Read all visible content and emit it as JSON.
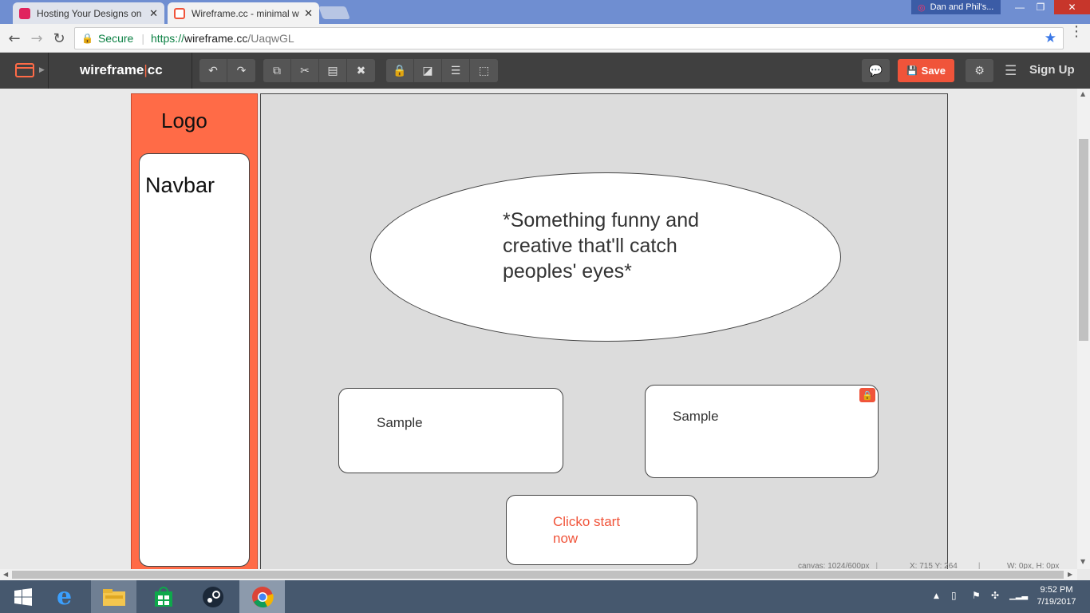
{
  "browser": {
    "tabs": [
      {
        "title": "Hosting Your Designs on",
        "active": false
      },
      {
        "title": "Wireframe.cc - minimal w",
        "active": true
      }
    ],
    "profile_name": "Dan and Phil's...",
    "security_label": "Secure",
    "url_protocol": "https://",
    "url_host": "wireframe.cc",
    "url_path": "/UaqwGL"
  },
  "toolbar": {
    "brand_left": "wireframe",
    "brand_sep": "|",
    "brand_right": "cc",
    "save_label": "Save",
    "signup_label": "Sign Up"
  },
  "wireframe": {
    "logo_text": "Logo",
    "navbar_text": "Navbar",
    "hero_text": "*Something funny and creative that'll catch peoples' eyes*",
    "card1_label": "Sample",
    "card2_label": "Sample",
    "cta_label": "Clicko start now"
  },
  "status": {
    "canvas": "canvas: 1024/600px",
    "coords": "X: 715 Y: 264",
    "size": "W: 0px, H: 0px"
  },
  "taskbar": {
    "time": "9:52 PM",
    "date": "7/19/2017"
  },
  "colors": {
    "accent": "#f0543a",
    "sidebar": "#ff6b47",
    "toolbar_bg": "#404040",
    "canvas_bg": "#dcdcdc"
  }
}
